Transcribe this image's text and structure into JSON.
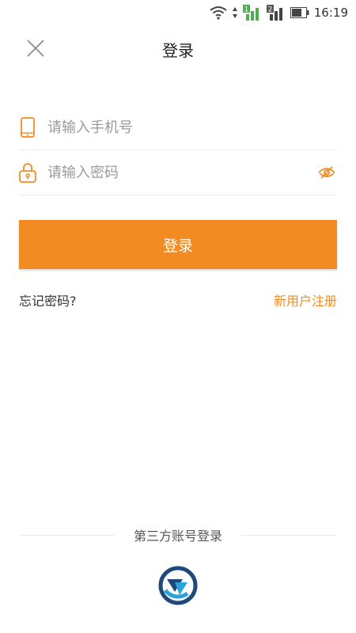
{
  "status_bar": {
    "time": "16:19",
    "sim1": "1",
    "sim2": "2",
    "icons": [
      "wifi-icon",
      "data-arrows-icon",
      "signal-sim1-icon",
      "signal-sim2-icon",
      "battery-icon"
    ]
  },
  "header": {
    "title": "登录",
    "close_icon": "close-icon"
  },
  "form": {
    "phone_placeholder": "请输入手机号",
    "password_placeholder": "请输入密码",
    "login_label": "登录"
  },
  "links": {
    "forgot": "忘记密码?",
    "register": "新用户注册"
  },
  "third_party": {
    "title": "第三方账号登录"
  },
  "colors": {
    "accent": "#F28C22",
    "text": "#333333",
    "placeholder": "#9a9a9a"
  }
}
